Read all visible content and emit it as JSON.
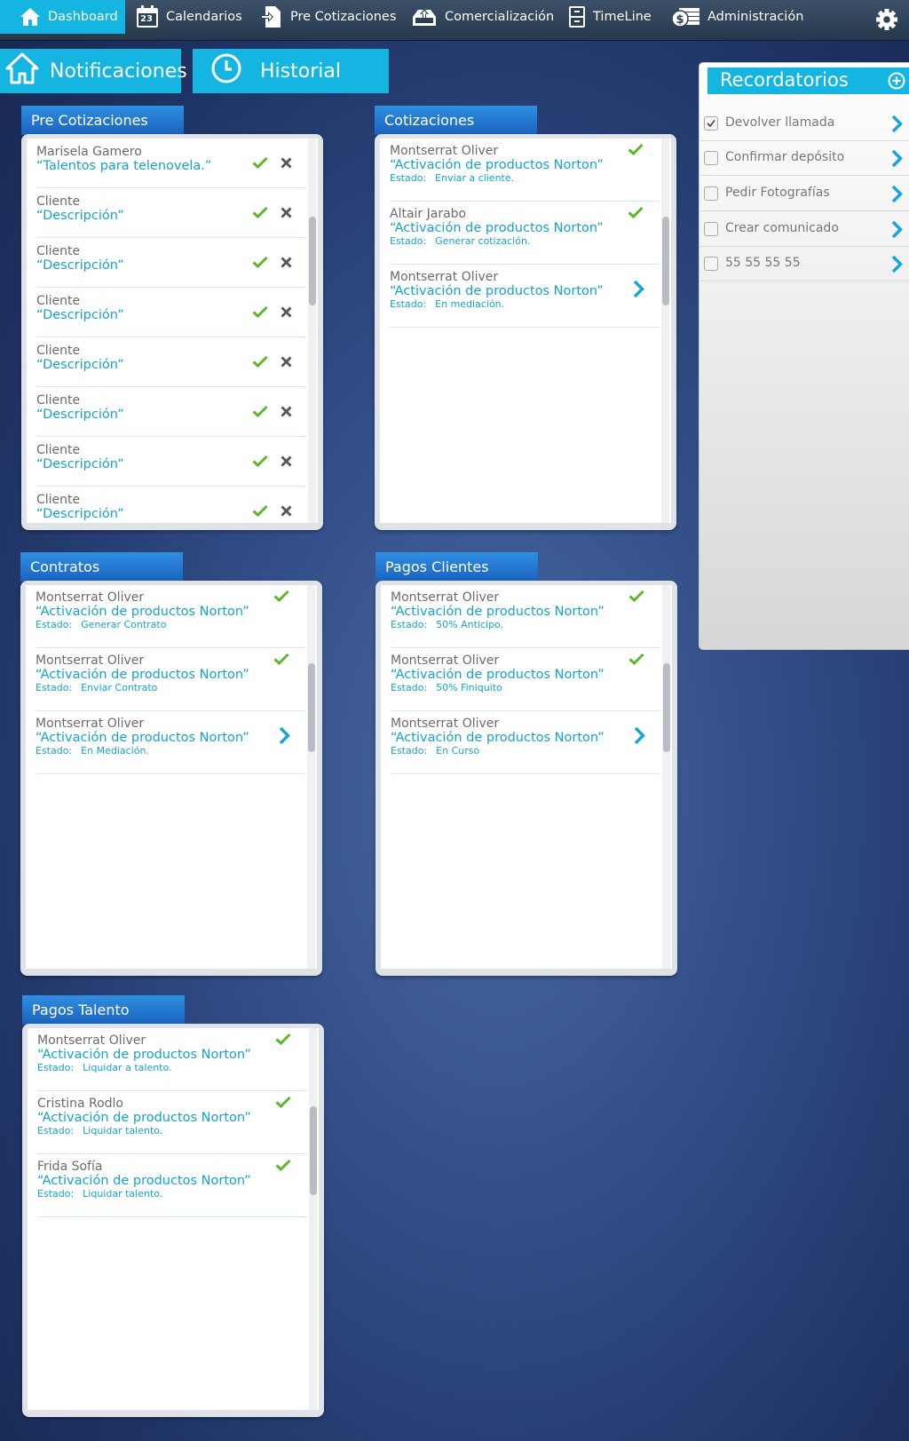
{
  "nav": {
    "items": [
      {
        "label": "Dashboard",
        "icon": "home-icon",
        "active": true
      },
      {
        "label": "Calendarios",
        "icon": "calendar-icon",
        "calendar_day": "23"
      },
      {
        "label": "Pre Cotizaciones",
        "icon": "document-arrow-icon"
      },
      {
        "label": "Comercialización",
        "icon": "inbox-upload-icon"
      },
      {
        "label": "TimeLine",
        "icon": "cabinet-icon"
      },
      {
        "label": "Administración",
        "icon": "money-stack-icon"
      }
    ],
    "settings_icon": "gear-icon"
  },
  "tabs": [
    {
      "label": "Notificaciones",
      "icon": "home-icon"
    },
    {
      "label": "Historial",
      "icon": "clock-icon"
    }
  ],
  "pre_cotizaciones": {
    "title": "Pre Cotizaciones",
    "items": [
      {
        "who": "Marisela Gamero",
        "desc": "“Talentos para telenovela.”"
      },
      {
        "who": "Cliente",
        "desc": "“Descripción”"
      },
      {
        "who": "Cliente",
        "desc": "“Descripción”"
      },
      {
        "who": "Cliente",
        "desc": "“Descripción”"
      },
      {
        "who": "Cliente",
        "desc": "“Descripción”"
      },
      {
        "who": "Cliente",
        "desc": "“Descripción”"
      },
      {
        "who": "Cliente",
        "desc": "“Descripción”"
      },
      {
        "who": "Cliente",
        "desc": "“Descripción”"
      }
    ]
  },
  "cotizaciones": {
    "title": "Cotizaciones",
    "items": [
      {
        "who": "Montserrat Oliver",
        "desc": "“Activación de productos Norton”",
        "estado_label": "Estado:",
        "estado": "Enviar a cliente.",
        "action": "check"
      },
      {
        "who": "Altair Jarabo",
        "desc": "“Activación de productos Norton”",
        "estado_label": "Estado:",
        "estado": "Generar cotización.",
        "action": "check"
      },
      {
        "who": "Montserrat Oliver",
        "desc": "“Activación de productos Norton”",
        "estado_label": "Estado:",
        "estado": "En mediación.",
        "action": "arrow"
      }
    ]
  },
  "contratos": {
    "title": "Contratos",
    "items": [
      {
        "who": "Montserrat Oliver",
        "desc": "“Activación de productos Norton”",
        "estado_label": "Estado:",
        "estado": "Generar Contrato",
        "action": "check"
      },
      {
        "who": "Montserrat Oliver",
        "desc": "“Activación de productos Norton”",
        "estado_label": "Estado:",
        "estado": "Enviar Contrato",
        "action": "check"
      },
      {
        "who": "Montserrat Oliver",
        "desc": "“Activación de productos Norton”",
        "estado_label": "Estado:",
        "estado": "En Mediación.",
        "action": "arrow"
      }
    ]
  },
  "pagos_clientes": {
    "title": "Pagos Clientes",
    "items": [
      {
        "who": "Montserrat Oliver",
        "desc": "“Activación de productos Norton”",
        "estado_label": "Estado:",
        "estado": "50% Anticipo.",
        "action": "check"
      },
      {
        "who": "Montserrat Oliver",
        "desc": "“Activación de productos Norton”",
        "estado_label": "Estado:",
        "estado": "50% Finiquito",
        "action": "check"
      },
      {
        "who": "Montserrat Oliver",
        "desc": "“Activación de productos Norton”",
        "estado_label": "Estado:",
        "estado": "En Curso",
        "action": "arrow"
      }
    ]
  },
  "pagos_talento": {
    "title": "Pagos Talento",
    "items": [
      {
        "who": "Montserrat Oliver",
        "desc": "“Activación de productos Norton”",
        "estado_label": "Estado:",
        "estado": "Liquidar a talento.",
        "action": "check"
      },
      {
        "who": "Cristina Rodlo",
        "desc": "“Activación de productos Norton”",
        "estado_label": "Estado:",
        "estado": "Liquidar talento.",
        "action": "check"
      },
      {
        "who": "Frida Sofía",
        "desc": "“Activación de productos Norton”",
        "estado_label": "Estado:",
        "estado": "Liquidar talento.",
        "action": "check"
      }
    ]
  },
  "recordatorios": {
    "title": "Recordatorios",
    "items": [
      {
        "label": "Devolver llamada",
        "checked": true
      },
      {
        "label": "Confirmar depósito",
        "checked": false
      },
      {
        "label": "Pedir Fotografías",
        "checked": false
      },
      {
        "label": "Crear comunicado",
        "checked": false
      },
      {
        "label": "55 55 55 55",
        "checked": false
      }
    ]
  },
  "colors": {
    "accent": "#14b5e0",
    "panel_tab": "#1a62c0",
    "check": "#5cb82a",
    "text_link": "#15a3c9"
  }
}
